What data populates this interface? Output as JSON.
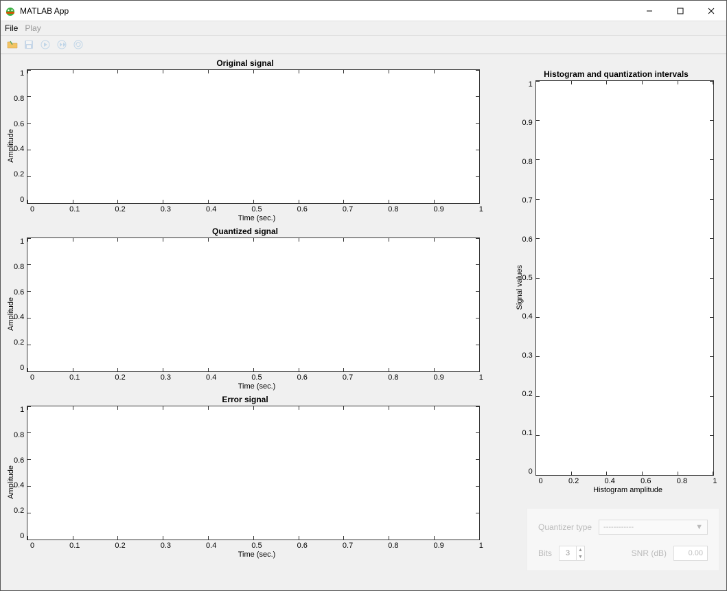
{
  "window": {
    "title": "MATLAB App"
  },
  "menu": {
    "file": "File",
    "play": "Play"
  },
  "plots": {
    "original": {
      "title": "Original signal",
      "ylabel": "Amplitude",
      "xlabel": "Time (sec.)"
    },
    "quantized": {
      "title": "Quantized signal",
      "ylabel": "Amplitude",
      "xlabel": "Time (sec.)"
    },
    "error": {
      "title": "Error signal",
      "ylabel": "Amplitude",
      "xlabel": "Time (sec.)"
    },
    "histogram": {
      "title": "Histogram and quantization intervals",
      "ylabel": "Signal values",
      "xlabel": "Histogram amplitude"
    }
  },
  "ticks": {
    "x_time": [
      "0",
      "0.1",
      "0.2",
      "0.3",
      "0.4",
      "0.5",
      "0.6",
      "0.7",
      "0.8",
      "0.9",
      "1"
    ],
    "y_amp": [
      "1",
      "0.8",
      "0.6",
      "0.4",
      "0.2",
      "0"
    ],
    "hist_y": [
      "1",
      "0.9",
      "0.8",
      "0.7",
      "0.6",
      "0.5",
      "0.4",
      "0.3",
      "0.2",
      "0.1",
      "0"
    ],
    "hist_x": [
      "0",
      "0.2",
      "0.4",
      "0.6",
      "0.8",
      "1"
    ]
  },
  "controls": {
    "quantizer_label": "Quantizer type",
    "quantizer_value": "------------",
    "bits_label": "Bits",
    "bits_value": "3",
    "snr_label": "SNR (dB)",
    "snr_value": "0.00"
  },
  "chart_data": [
    {
      "type": "line",
      "title": "Original signal",
      "xlabel": "Time (sec.)",
      "ylabel": "Amplitude",
      "xlim": [
        0,
        1
      ],
      "ylim": [
        0,
        1
      ],
      "x": [],
      "y": []
    },
    {
      "type": "line",
      "title": "Quantized signal",
      "xlabel": "Time (sec.)",
      "ylabel": "Amplitude",
      "xlim": [
        0,
        1
      ],
      "ylim": [
        0,
        1
      ],
      "x": [],
      "y": []
    },
    {
      "type": "line",
      "title": "Error signal",
      "xlabel": "Time (sec.)",
      "ylabel": "Amplitude",
      "xlim": [
        0,
        1
      ],
      "ylim": [
        0,
        1
      ],
      "x": [],
      "y": []
    },
    {
      "type": "bar",
      "title": "Histogram and quantization intervals",
      "xlabel": "Histogram amplitude",
      "ylabel": "Signal values",
      "xlim": [
        0,
        1
      ],
      "ylim": [
        0,
        1
      ],
      "categories": [],
      "values": []
    }
  ]
}
